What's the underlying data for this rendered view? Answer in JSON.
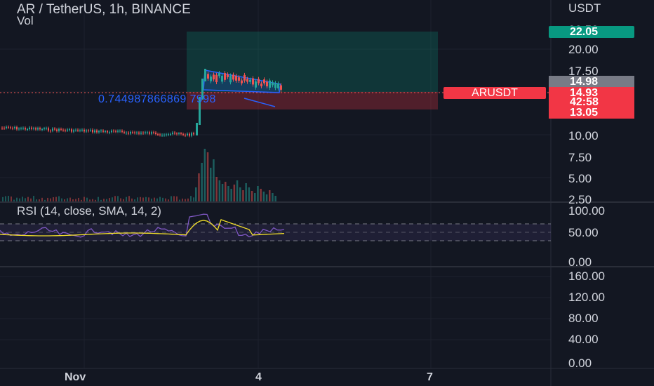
{
  "header": {
    "symbol_title": "AR / TetherUS, 1h, BINANCE",
    "volume_label": "Vol"
  },
  "price_axis": {
    "currency": "USDT",
    "ticks": [
      "22.50",
      "20.00",
      "17.50",
      "10.00",
      "7.50",
      "5.00",
      "2.50"
    ]
  },
  "price_tags": {
    "target": "22.05",
    "high": "14.98",
    "last": "14.93",
    "countdown": "42:58",
    "stop": "13.05",
    "symbol_badge": "ARUSDT"
  },
  "fib_annotation": "0.744987866869 7998",
  "rsi": {
    "label": "RSI (14, close, SMA, 14, 2)",
    "ticks": [
      "100.00",
      "50.00",
      "0.00"
    ]
  },
  "lower_pane": {
    "ticks": [
      "160.00",
      "120.00",
      "80.00",
      "40.00",
      "0.00"
    ]
  },
  "time_axis": {
    "ticks": [
      "Nov",
      "4",
      "7"
    ]
  },
  "colors": {
    "background": "#131722",
    "up": "#26a69a",
    "down": "#ef5350",
    "target_tag": "#089981",
    "stop_tag": "#f23645",
    "rsi_line": "#7e57c2",
    "rsi_ma": "#f5e12a",
    "pattern": "#2962ff"
  }
}
